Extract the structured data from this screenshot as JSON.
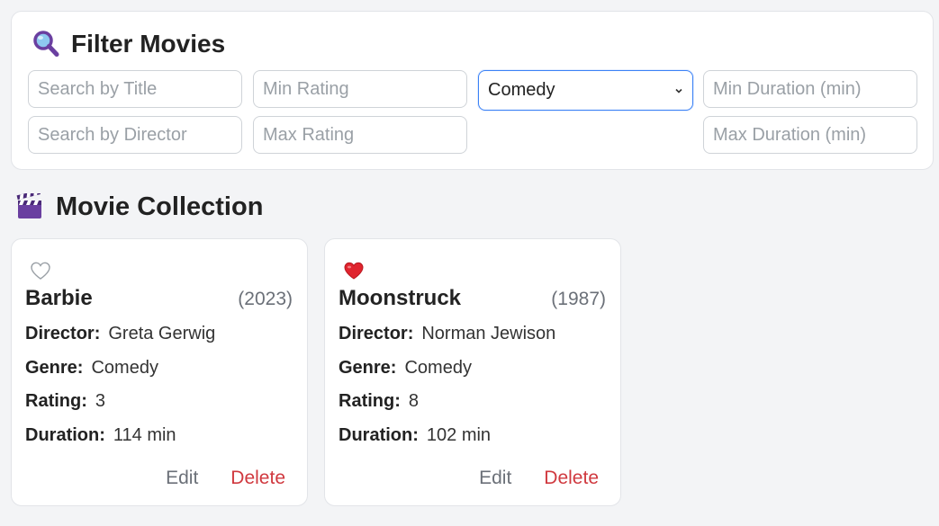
{
  "filter": {
    "title": "Filter Movies",
    "title_placeholder": "Search by Title",
    "director_placeholder": "Search by Director",
    "min_rating_placeholder": "Min Rating",
    "max_rating_placeholder": "Max Rating",
    "genre_selected": "Comedy",
    "min_duration_placeholder": "Min Duration (min)",
    "max_duration_placeholder": "Max Duration (min)",
    "icon": "magnifying-glass-icon"
  },
  "collection": {
    "title": "Movie Collection",
    "icon": "clapper-board-icon",
    "labels": {
      "director": "Director:",
      "genre": "Genre:",
      "rating": "Rating:",
      "duration": "Duration:",
      "edit": "Edit",
      "delete": "Delete"
    },
    "movies": [
      {
        "title": "Barbie",
        "year": "(2023)",
        "director": "Greta Gerwig",
        "genre": "Comedy",
        "rating": "3",
        "duration": "114 min",
        "favorite": false
      },
      {
        "title": "Moonstruck",
        "year": "(1987)",
        "director": "Norman Jewison",
        "genre": "Comedy",
        "rating": "8",
        "duration": "102 min",
        "favorite": true
      }
    ]
  },
  "colors": {
    "accent": "#3b82f6",
    "delete": "#d0393f",
    "heart_favorite": "#e0242e",
    "heart_empty": "#ffffff"
  }
}
